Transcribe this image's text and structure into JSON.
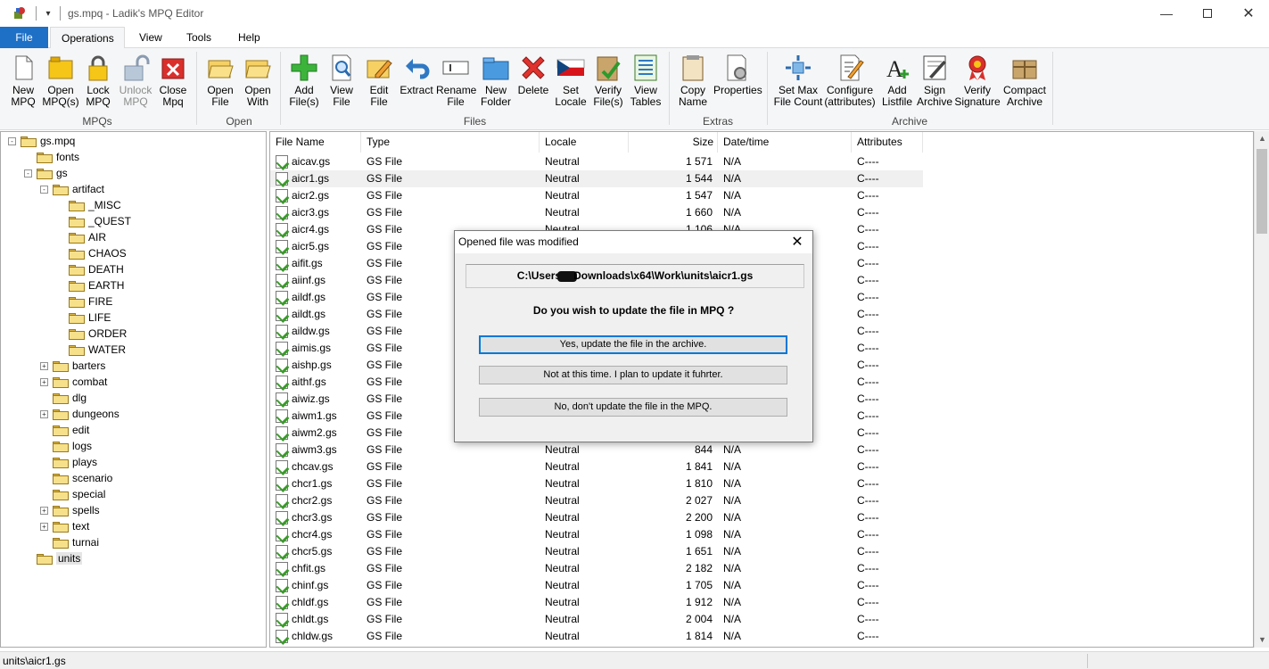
{
  "window": {
    "title": "gs.mpq - Ladik's MPQ Editor"
  },
  "tabs": [
    "File",
    "Operations",
    "View",
    "Tools",
    "Help"
  ],
  "ribbon": {
    "groups": [
      {
        "label": "MPQs",
        "buttons": [
          {
            "label": "New\nMPQ",
            "icon": "new-mpq-icon"
          },
          {
            "label": "Open\nMPQ(s)",
            "icon": "open-mpq-icon"
          },
          {
            "label": "Lock\nMPQ",
            "icon": "lock-icon"
          },
          {
            "label": "Unlock\nMPQ",
            "icon": "unlock-icon",
            "disabled": true
          },
          {
            "label": "Close\nMpq",
            "icon": "close-mpq-icon"
          }
        ]
      },
      {
        "label": "Open",
        "buttons": [
          {
            "label": "Open\nFile",
            "icon": "open-folder-icon"
          },
          {
            "label": "Open\nWith",
            "icon": "open-with-icon"
          }
        ]
      },
      {
        "label": "Files",
        "buttons": [
          {
            "label": "Add\nFile(s)",
            "icon": "add-icon"
          },
          {
            "label": "View\nFile",
            "icon": "view-file-icon"
          },
          {
            "label": "Edit\nFile",
            "icon": "edit-file-icon"
          },
          {
            "label": "Extract",
            "icon": "extract-icon"
          },
          {
            "label": "Rename\nFile",
            "icon": "rename-icon"
          },
          {
            "label": "New\nFolder",
            "icon": "new-folder-icon"
          },
          {
            "label": "Delete",
            "icon": "delete-icon"
          },
          {
            "label": "Set\nLocale",
            "icon": "czech-flag-icon"
          },
          {
            "label": "Verify\nFile(s)",
            "icon": "verify-files-icon"
          },
          {
            "label": "View\nTables",
            "icon": "view-tables-icon"
          }
        ]
      },
      {
        "label": "Extras",
        "buttons": [
          {
            "label": "Copy\nName",
            "icon": "copy-name-icon"
          },
          {
            "label": "Properties",
            "icon": "properties-icon"
          }
        ]
      },
      {
        "label": "Archive",
        "buttons": [
          {
            "label": "Set Max\nFile Count",
            "icon": "set-max-icon"
          },
          {
            "label": "Configure\n(attributes)",
            "icon": "configure-icon"
          },
          {
            "label": "Add\nListfile",
            "icon": "add-listfile-icon"
          },
          {
            "label": "Sign\nArchive",
            "icon": "sign-archive-icon"
          },
          {
            "label": "Verify\nSignature",
            "icon": "verify-signature-icon"
          },
          {
            "label": "Compact\nArchive",
            "icon": "compact-archive-icon"
          }
        ]
      }
    ]
  },
  "tree": [
    {
      "label": "gs.mpq",
      "level": 0,
      "toggle": "-"
    },
    {
      "label": "fonts",
      "level": 1,
      "toggle": ""
    },
    {
      "label": "gs",
      "level": 1,
      "toggle": "-"
    },
    {
      "label": "artifact",
      "level": 2,
      "toggle": "-"
    },
    {
      "label": "_MISC",
      "level": 3,
      "toggle": ""
    },
    {
      "label": "_QUEST",
      "level": 3,
      "toggle": ""
    },
    {
      "label": "AIR",
      "level": 3,
      "toggle": ""
    },
    {
      "label": "CHAOS",
      "level": 3,
      "toggle": ""
    },
    {
      "label": "DEATH",
      "level": 3,
      "toggle": ""
    },
    {
      "label": "EARTH",
      "level": 3,
      "toggle": ""
    },
    {
      "label": "FIRE",
      "level": 3,
      "toggle": ""
    },
    {
      "label": "LIFE",
      "level": 3,
      "toggle": ""
    },
    {
      "label": "ORDER",
      "level": 3,
      "toggle": ""
    },
    {
      "label": "WATER",
      "level": 3,
      "toggle": ""
    },
    {
      "label": "barters",
      "level": 2,
      "toggle": "+"
    },
    {
      "label": "combat",
      "level": 2,
      "toggle": "+"
    },
    {
      "label": "dlg",
      "level": 2,
      "toggle": ""
    },
    {
      "label": "dungeons",
      "level": 2,
      "toggle": "+"
    },
    {
      "label": "edit",
      "level": 2,
      "toggle": ""
    },
    {
      "label": "logs",
      "level": 2,
      "toggle": ""
    },
    {
      "label": "plays",
      "level": 2,
      "toggle": ""
    },
    {
      "label": "scenario",
      "level": 2,
      "toggle": ""
    },
    {
      "label": "special",
      "level": 2,
      "toggle": ""
    },
    {
      "label": "spells",
      "level": 2,
      "toggle": "+"
    },
    {
      "label": "text",
      "level": 2,
      "toggle": "+"
    },
    {
      "label": "turnai",
      "level": 2,
      "toggle": ""
    },
    {
      "label": "units",
      "level": 1,
      "toggle": "",
      "selected": true
    }
  ],
  "list": {
    "columns": [
      "File Name",
      "Type",
      "Locale",
      "Size",
      "Date/time",
      "Attributes"
    ],
    "rows": [
      [
        "aicav.gs",
        "GS File",
        "Neutral",
        "1 571",
        "N/A",
        "C----"
      ],
      [
        "aicr1.gs",
        "GS File",
        "Neutral",
        "1 544",
        "N/A",
        "C----"
      ],
      [
        "aicr2.gs",
        "GS File",
        "Neutral",
        "1 547",
        "N/A",
        "C----"
      ],
      [
        "aicr3.gs",
        "GS File",
        "Neutral",
        "1 660",
        "N/A",
        "C----"
      ],
      [
        "aicr4.gs",
        "GS File",
        "Neutral",
        "1 106",
        "N/A",
        "C----"
      ],
      [
        "aicr5.gs",
        "GS File",
        "",
        "",
        "",
        "C----"
      ],
      [
        "aifit.gs",
        "GS File",
        "",
        "",
        "",
        "C----"
      ],
      [
        "aiinf.gs",
        "GS File",
        "",
        "",
        "",
        "C----"
      ],
      [
        "aildf.gs",
        "GS File",
        "",
        "",
        "",
        "C----"
      ],
      [
        "aildt.gs",
        "GS File",
        "",
        "",
        "",
        "C----"
      ],
      [
        "aildw.gs",
        "GS File",
        "",
        "",
        "",
        "C----"
      ],
      [
        "aimis.gs",
        "GS File",
        "",
        "",
        "",
        "C----"
      ],
      [
        "aishp.gs",
        "GS File",
        "",
        "",
        "",
        "C----"
      ],
      [
        "aithf.gs",
        "GS File",
        "",
        "",
        "",
        "C----"
      ],
      [
        "aiwiz.gs",
        "GS File",
        "",
        "",
        "",
        "C----"
      ],
      [
        "aiwm1.gs",
        "GS File",
        "",
        "",
        "",
        "C----"
      ],
      [
        "aiwm2.gs",
        "GS File",
        "",
        "",
        "",
        "C----"
      ],
      [
        "aiwm3.gs",
        "GS File",
        "Neutral",
        "844",
        "N/A",
        "C----"
      ],
      [
        "chcav.gs",
        "GS File",
        "Neutral",
        "1 841",
        "N/A",
        "C----"
      ],
      [
        "chcr1.gs",
        "GS File",
        "Neutral",
        "1 810",
        "N/A",
        "C----"
      ],
      [
        "chcr2.gs",
        "GS File",
        "Neutral",
        "2 027",
        "N/A",
        "C----"
      ],
      [
        "chcr3.gs",
        "GS File",
        "Neutral",
        "2 200",
        "N/A",
        "C----"
      ],
      [
        "chcr4.gs",
        "GS File",
        "Neutral",
        "1 098",
        "N/A",
        "C----"
      ],
      [
        "chcr5.gs",
        "GS File",
        "Neutral",
        "1 651",
        "N/A",
        "C----"
      ],
      [
        "chfit.gs",
        "GS File",
        "Neutral",
        "2 182",
        "N/A",
        "C----"
      ],
      [
        "chinf.gs",
        "GS File",
        "Neutral",
        "1 705",
        "N/A",
        "C----"
      ],
      [
        "chldf.gs",
        "GS File",
        "Neutral",
        "1 912",
        "N/A",
        "C----"
      ],
      [
        "chldt.gs",
        "GS File",
        "Neutral",
        "2 004",
        "N/A",
        "C----"
      ],
      [
        "chldw.gs",
        "GS File",
        "Neutral",
        "1 814",
        "N/A",
        "C----"
      ]
    ]
  },
  "status": {
    "path": "units\\aicr1.gs"
  },
  "dialog": {
    "title": "Opened file was modified",
    "path_before": "C:\\Users",
    "path_after": "Downloads\\x64\\Work\\units\\aicr1.gs",
    "question": "Do you wish to update the file in MPQ ?",
    "buttons": [
      "Yes, update the file in the archive.",
      "Not at this time. I plan to update it fuhrter.",
      "No, don't update the file in the MPQ."
    ]
  }
}
